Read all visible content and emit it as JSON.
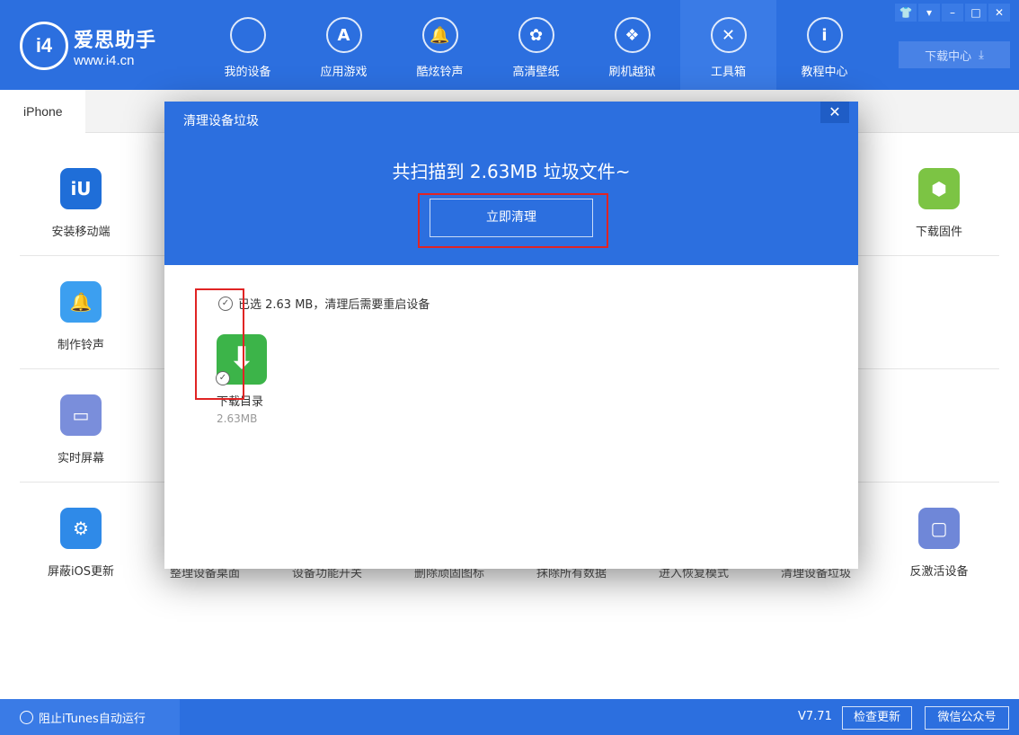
{
  "app": {
    "logo_name": "爱思助手",
    "logo_url": "www.i4.cn",
    "logo_mark": "i4"
  },
  "nav": [
    {
      "label": "我的设备",
      "icon": "apple-icon",
      "glyph": ""
    },
    {
      "label": "应用游戏",
      "icon": "app-store-icon",
      "glyph": "A"
    },
    {
      "label": "酷炫铃声",
      "icon": "bell-icon",
      "glyph": "🔔"
    },
    {
      "label": "高清壁纸",
      "icon": "flower-icon",
      "glyph": "✿"
    },
    {
      "label": "刷机越狱",
      "icon": "box-icon",
      "glyph": "❖"
    },
    {
      "label": "工具箱",
      "icon": "tools-icon",
      "glyph": "✕"
    },
    {
      "label": "教程中心",
      "icon": "info-icon",
      "glyph": "i"
    }
  ],
  "active_nav": "工具箱",
  "window_controls": [
    "skin",
    "menu",
    "minimize",
    "maximize",
    "close"
  ],
  "download_center": {
    "label": "下载中心",
    "icon": "download-icon"
  },
  "tab": "iPhone",
  "tools": {
    "left": [
      {
        "label": "安装移动端",
        "color": "#1f6ed8",
        "glyph": "iU"
      },
      {
        "label": "制作铃声",
        "color": "#3c9ff0",
        "glyph": "🔔"
      },
      {
        "label": "实时屏幕",
        "color": "#7a8edb",
        "glyph": "▭"
      },
      {
        "label": "屏蔽iOS更新",
        "color": "#2f8ae8",
        "glyph": "⚙"
      }
    ],
    "right": [
      {
        "label": "下载固件",
        "color": "#7cc444",
        "glyph": "⬢"
      },
      {
        "label": "反激活设备",
        "color": "#6f87d8",
        "glyph": "▢"
      }
    ],
    "bottom_row": [
      "整理设备桌面",
      "设备功能开关",
      "删除顽固图标",
      "抹除所有数据",
      "进入恢复模式",
      "清理设备垃圾"
    ]
  },
  "dialog": {
    "title": "清理设备垃圾",
    "headline": "共扫描到 2.63MB 垃圾文件~",
    "clean_button": "立即清理",
    "selection_text": "已选 2.63 MB，清理后需要重启设备",
    "items": [
      {
        "name": "下载目录",
        "size": "2.63MB",
        "checked": true
      }
    ]
  },
  "footer": {
    "itunes_toggle": "阻止iTunes自动运行",
    "version": "V7.71",
    "check_update": "检查更新",
    "wechat": "微信公众号"
  },
  "colors": {
    "brand": "#2c6fdf",
    "annotation": "#e02424",
    "item_green": "#3cb449"
  }
}
